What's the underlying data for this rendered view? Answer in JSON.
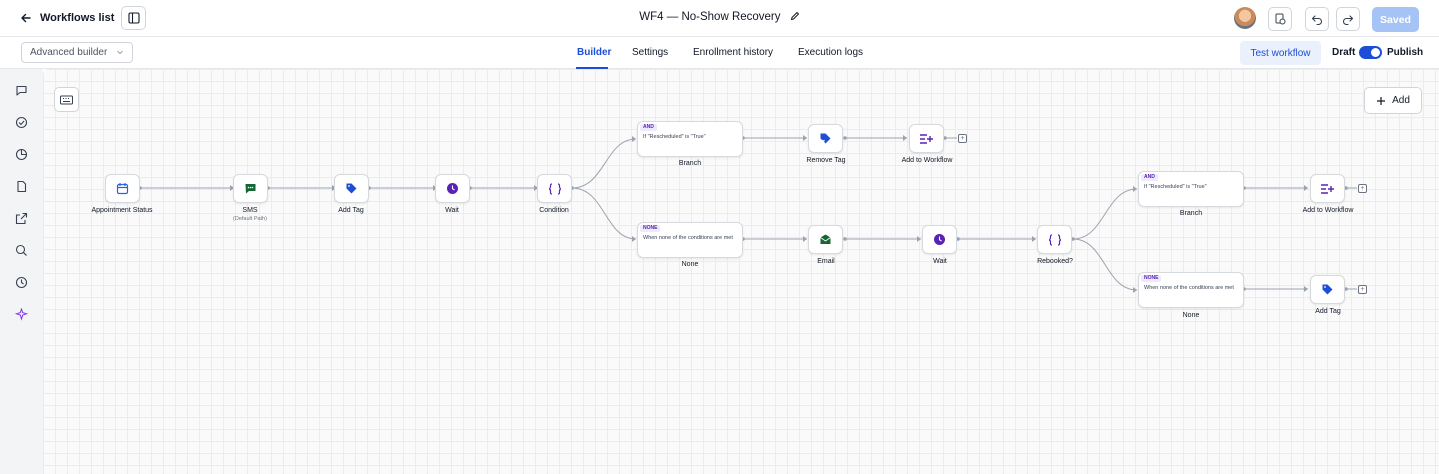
{
  "topbar": {
    "back_label": "Workflows list",
    "title": "WF4 — No-Show Recovery",
    "saved_label": "Saved"
  },
  "subbar": {
    "builder_mode": "Advanced builder",
    "tabs": [
      {
        "label": "Builder",
        "active": true
      },
      {
        "label": "Settings",
        "active": false
      },
      {
        "label": "Enrollment history",
        "active": false
      },
      {
        "label": "Execution logs",
        "active": false
      }
    ],
    "test_label": "Test workflow",
    "draft_label": "Draft",
    "publish_label": "Publish",
    "published": true
  },
  "canvas": {
    "add_label": "Add"
  },
  "nodes": {
    "appointment_status": {
      "label": "Appointment Status",
      "icon": "calendar-icon"
    },
    "sms": {
      "label": "SMS",
      "sub": "(Default Path)",
      "icon": "chat-icon"
    },
    "add_tag_1": {
      "label": "Add Tag",
      "icon": "tag-icon"
    },
    "wait_1": {
      "label": "Wait",
      "icon": "clock-icon"
    },
    "condition": {
      "label": "Condition",
      "icon": "braces-icon"
    },
    "branch_1": {
      "chip": "AND",
      "text": "If \"Rescheduled\" is \"True\"",
      "label": "Branch"
    },
    "none_1": {
      "chip": "NONE",
      "text": "When none of the conditions are met",
      "label": "None"
    },
    "remove_tag": {
      "label": "Remove Tag",
      "icon": "tag-remove-icon"
    },
    "add_to_workflow_1": {
      "label": "Add to Workflow",
      "icon": "list-plus-icon"
    },
    "email": {
      "label": "Email",
      "icon": "mail-icon"
    },
    "wait_2": {
      "label": "Wait",
      "icon": "clock-icon"
    },
    "rebooked": {
      "label": "Rebooked?",
      "icon": "braces-icon"
    },
    "branch_2": {
      "chip": "AND",
      "text": "If \"Rescheduled\" is \"True\"",
      "label": "Branch"
    },
    "none_2": {
      "chip": "NONE",
      "text": "When none of the conditions are met",
      "label": "None"
    },
    "add_to_workflow_2": {
      "label": "Add to Workflow",
      "icon": "list-plus-icon"
    },
    "add_tag_2": {
      "label": "Add Tag",
      "icon": "tag-icon"
    }
  },
  "colors": {
    "accent": "#1d4ed8",
    "purple": "#5b21b6",
    "green": "#166534",
    "connector": "#9ca3af"
  }
}
